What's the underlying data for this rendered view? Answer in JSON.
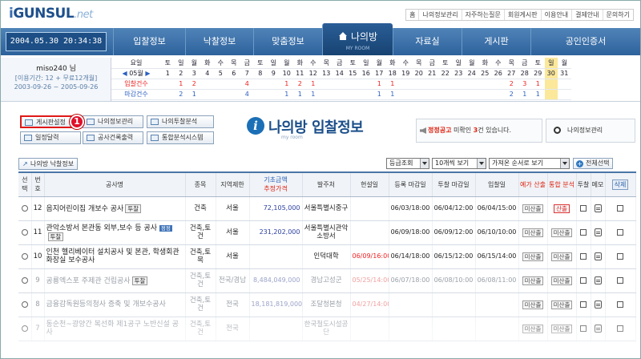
{
  "logo": {
    "part1": "i",
    "part2": "GUNSUL",
    "part3": ".net"
  },
  "top_links": [
    "홈",
    "나의정보관리",
    "자주하는질문",
    "회원게시판",
    "이용안내",
    "결제안내",
    "문의하기"
  ],
  "datetime": "2004.05.30 20:34:38",
  "nav": {
    "items": [
      "입찰정보",
      "낙찰정보",
      "맞춤정보",
      "나의방",
      "자료실",
      "게시판",
      "공인인증서"
    ],
    "active_sub": "MY ROOM"
  },
  "user": {
    "name": "miso240 님",
    "period": "[이용기간: 12 + 무료12개월]",
    "dates": "2003-09-26 ~ 2005-09-26"
  },
  "calendar": {
    "label_week": "요일",
    "label_month": "05월",
    "label_bid": "입찰건수",
    "label_close": "마감건수",
    "weekdays": [
      "토",
      "일",
      "월",
      "화",
      "수",
      "목",
      "금",
      "토",
      "일",
      "월",
      "화",
      "수",
      "목",
      "금",
      "토",
      "일",
      "월",
      "화",
      "수",
      "목",
      "금",
      "토",
      "일",
      "월",
      "화",
      "수",
      "목",
      "금",
      "토",
      "일",
      "월"
    ],
    "days": [
      "1",
      "2",
      "3",
      "4",
      "5",
      "6",
      "7",
      "8",
      "9",
      "10",
      "11",
      "12",
      "13",
      "14",
      "15",
      "16",
      "17",
      "18",
      "19",
      "20",
      "21",
      "22",
      "23",
      "24",
      "25",
      "26",
      "27",
      "28",
      "29",
      "30",
      "31"
    ],
    "bids": [
      "",
      "1",
      "2",
      "",
      "",
      "",
      "4",
      "",
      "",
      "1",
      "2",
      "1",
      "",
      "",
      "",
      "",
      "1",
      "1",
      "",
      "",
      "",
      "",
      "",
      "",
      "",
      "",
      "2",
      "3",
      "1",
      "",
      ""
    ],
    "closes": [
      "",
      "2",
      "1",
      "",
      "",
      "",
      "4",
      "",
      "",
      "1",
      "1",
      "1",
      "",
      "",
      "",
      "",
      "1",
      "1",
      "",
      "",
      "",
      "",
      "",
      "",
      "",
      "",
      "2",
      "1",
      "1",
      "",
      ""
    ]
  },
  "buttons": {
    "board_settings": "게시판설정",
    "my_info": "나의정보관리",
    "my_analysis": "나의투찰분석",
    "schedule": "일정달력",
    "company_print": "공사건록출력",
    "stats_system": "통합분석시스템",
    "history": "나의방 낙찰정보",
    "select_all": "전체선택"
  },
  "badge": "1",
  "title": {
    "icon": "i",
    "main": "나의방 입찰정보",
    "sub": "my room"
  },
  "notice": {
    "prefix": "정정공고",
    "middle": " 미확인 ",
    "count": "3",
    "suffix": "건 있습니다."
  },
  "myinfo_label": "나의정보관리",
  "selects": {
    "grade": "등급조회",
    "page_size": "10개씩 보기",
    "sort": "가져온 순서로 보기"
  },
  "table": {
    "headers": {
      "select": "선택",
      "no": "번호",
      "name": "공사명",
      "type": "종목",
      "region": "지역제한",
      "amount_top": "기초금액",
      "amount_bottom": "추정가격",
      "org": "발주처",
      "site": "현설일",
      "reg": "등록 마감일",
      "bid_close": "투찰 마감일",
      "bid_date": "입찰일",
      "price": "예가 산출",
      "analysis": "통합 분석",
      "bid": "투찰",
      "memo": "메모",
      "delete": "삭제"
    },
    "rows": [
      {
        "no": "12",
        "name": "음지어린이집 개보수 공사",
        "tag": "투찰",
        "type": "건축",
        "region": "서울",
        "amount": "72,105,000",
        "org": "서울특별시중구",
        "site": "",
        "reg": "06/03/18:00",
        "bid_close": "06/04/12:00",
        "bid_date": "06/04/15:00",
        "price": "미산출",
        "analysis": "산출",
        "faded": false
      },
      {
        "no": "11",
        "name": "관악소방서 본관동 외부,보수 등 공사",
        "newtag": "정정",
        "tag": "투찰",
        "type": "건축,토건",
        "region": "서울",
        "amount": "231,202,000",
        "org": "서울특별시관악소방서",
        "site": "",
        "reg": "06/09/18:00",
        "bid_close": "06/09/12:00",
        "bid_date": "06/10/10:00",
        "price": "미산출",
        "analysis": "미산출",
        "faded": false
      },
      {
        "no": "10",
        "name": "인천 헬리베이터 설치공사 및 본관, 학생회관 화장실 보수공사",
        "tag": "",
        "type": "건축,토목",
        "region": "서울",
        "amount": "",
        "org": "인덕대학",
        "site": "06/09/16:00",
        "reg": "06/14/18:00",
        "bid_close": "06/15/12:00",
        "bid_date": "06/15/14:00",
        "price": "미산출",
        "analysis": "미산출",
        "faded": false
      },
      {
        "no": "9",
        "name": "공룡엑스포 주제관 건립공사",
        "tag": "투찰",
        "type": "건축,토건",
        "region": "전국/경남",
        "amount": "8,484,049,000",
        "org": "경남고성군",
        "site": "05/25/14:00",
        "reg": "06/07/18:00",
        "bid_close": "06/08/10:00",
        "bid_date": "06/08/11:00",
        "price": "미산출",
        "analysis": "미산출",
        "faded": true
      },
      {
        "no": "8",
        "name": "금융감독원등의청사 증축 및 개보수공사",
        "tag": "",
        "type": "건축,토건",
        "region": "전국",
        "amount": "18,181,819,000",
        "org": "조달청본청",
        "site": "04/27/14:00",
        "reg": "",
        "bid_close": "",
        "bid_date": "",
        "price": "미산출",
        "analysis": "미산출",
        "faded": true
      },
      {
        "no": "7",
        "name": "동순천~광양간 복선화 제1공구 노반신설 공사",
        "tag": "",
        "type": "건축,토건",
        "region": "전국",
        "amount": "",
        "org": "한국철도시설공단",
        "site": "",
        "reg": "",
        "bid_close": "",
        "bid_date": "",
        "price": "미산출",
        "analysis": "미산출",
        "faded": true
      }
    ]
  }
}
